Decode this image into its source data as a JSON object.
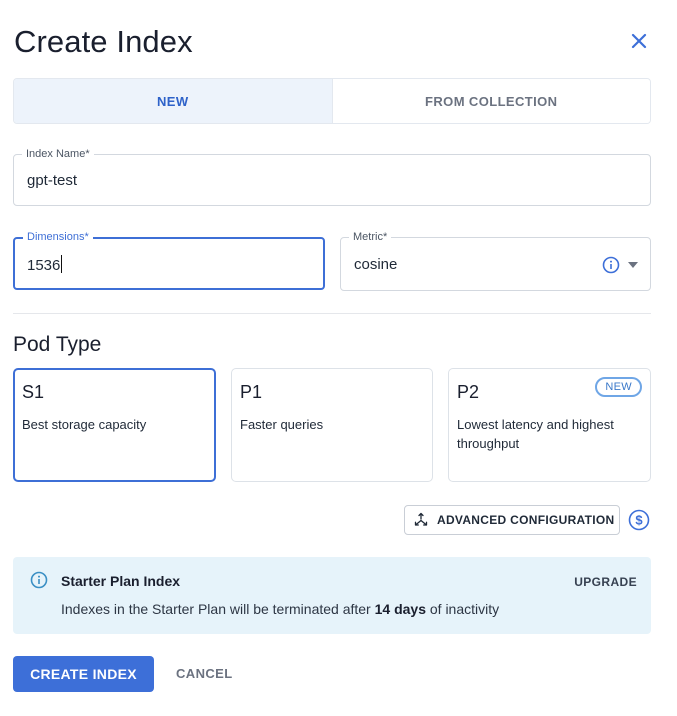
{
  "dialog": {
    "title": "Create Index",
    "close_icon": "close-icon"
  },
  "tabs": [
    {
      "label": "NEW",
      "active": true
    },
    {
      "label": "FROM COLLECTION",
      "active": false
    }
  ],
  "form": {
    "index_name": {
      "label": "Index Name",
      "required_mark": "*",
      "value": "gpt-test"
    },
    "dimensions": {
      "label": "Dimensions",
      "required_mark": "*",
      "value": "1536"
    },
    "metric": {
      "label": "Metric",
      "required_mark": "*",
      "value": "cosine",
      "icons": [
        "info-icon",
        "chevron-down-icon"
      ]
    }
  },
  "pod_type": {
    "title": "Pod Type",
    "options": [
      {
        "name": "S1",
        "description": "Best storage capacity",
        "selected": true
      },
      {
        "name": "P1",
        "description": "Faster queries",
        "selected": false
      },
      {
        "name": "P2",
        "description": "Lowest latency and highest throughput",
        "selected": false,
        "badge": "NEW"
      }
    ]
  },
  "advanced": {
    "label": "ADVANCED CONFIGURATION",
    "icon": "expand-arrows-icon",
    "cost_icon": "dollar-circle-icon"
  },
  "banner": {
    "icon": "info-icon",
    "title": "Starter Plan Index",
    "message_prefix": "Indexes in the Starter Plan will be terminated after ",
    "message_emphasis": "14 days",
    "message_suffix": " of inactivity",
    "action": "UPGRADE"
  },
  "actions": {
    "create": "CREATE INDEX",
    "cancel": "CANCEL"
  },
  "colors": {
    "accent": "#3d6fd8",
    "banner_bg": "#e6f3fa",
    "tab_active_bg": "#edf3fb"
  }
}
